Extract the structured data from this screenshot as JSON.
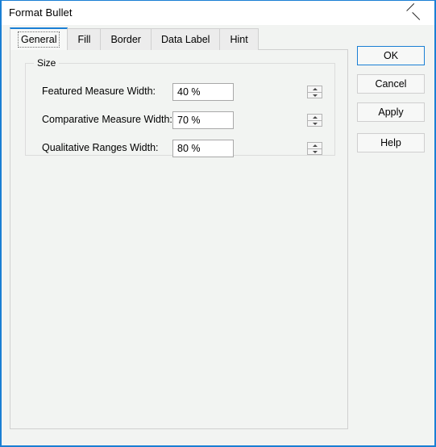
{
  "window": {
    "title": "Format Bullet",
    "close_icon": "close-icon",
    "accent_color": "#1a7fd4",
    "background_color": "#f2f4f2",
    "titlebar_color": "#ffffff"
  },
  "tabs": [
    {
      "label": "General",
      "selected": true
    },
    {
      "label": "Fill",
      "selected": false
    },
    {
      "label": "Border",
      "selected": false
    },
    {
      "label": "Data Label",
      "selected": false
    },
    {
      "label": "Hint",
      "selected": false
    }
  ],
  "general_tab": {
    "size_group": {
      "legend": "Size",
      "fields": [
        {
          "label": "Featured Measure Width:",
          "value": "40 %",
          "placeholder": "",
          "name": "featured-measure-width"
        },
        {
          "label": "Comparative Measure Width:",
          "value": "70 %",
          "placeholder": "",
          "name": "comparative-measure-width"
        },
        {
          "label": "Qualitative Ranges Width:",
          "value": "80 %",
          "placeholder": "",
          "name": "qualitative-ranges-width"
        }
      ]
    }
  },
  "buttons": {
    "ok": "OK",
    "cancel": "Cancel",
    "apply": "Apply",
    "help": "Help"
  }
}
